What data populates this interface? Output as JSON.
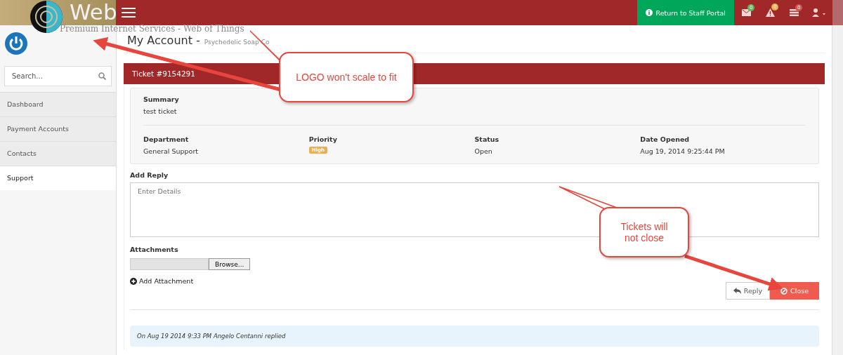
{
  "logo": {
    "wordmark": "Web",
    "tagline": "Premium Internet Services - Web of Things"
  },
  "topbar": {
    "portal_link": "Return to Staff Portal",
    "badges": [
      {
        "kind": "mail",
        "count": "0",
        "color": "#5cb85c"
      },
      {
        "kind": "alert",
        "count": "0",
        "color": "#f0ad4e"
      },
      {
        "kind": "tasks",
        "count": "0",
        "color": "#d9534f"
      }
    ]
  },
  "sidebar": {
    "search": {
      "placeholder": "Search..."
    },
    "items": [
      {
        "label": "Dashboard",
        "selected": false
      },
      {
        "label": "Payment Accounts",
        "selected": false
      },
      {
        "label": "Contacts",
        "selected": false
      },
      {
        "label": "Support",
        "selected": true
      }
    ]
  },
  "page": {
    "title": "My Account -",
    "subtitle": "Psychedelic Soap Co"
  },
  "ticket": {
    "title": "Ticket #9154291",
    "summary_label": "Summary",
    "summary": "test ticket",
    "fields": [
      {
        "label": "Department",
        "value": "General Support",
        "kind": "text"
      },
      {
        "label": "Priority",
        "value": "High",
        "kind": "badge"
      },
      {
        "label": "Status",
        "value": "Open",
        "kind": "text"
      },
      {
        "label": "Date Opened",
        "value": "Aug 19, 2014 9:25:44 PM",
        "kind": "text"
      }
    ]
  },
  "reply": {
    "label": "Add Reply",
    "placeholder": "Enter Details",
    "attachments_label": "Attachments",
    "browse": "Browse...",
    "add_attachment": "Add Attachment",
    "buttons": [
      {
        "label": "Reply",
        "kind": "reply"
      },
      {
        "label": "Close",
        "kind": "close"
      }
    ]
  },
  "history": [
    {
      "text": "On Aug 19 2014 9:33 PM Angelo Centanni replied"
    }
  ],
  "callouts": [
    {
      "text": "LOGO won't scale to fit"
    },
    {
      "text": "Tickets will not close"
    }
  ]
}
